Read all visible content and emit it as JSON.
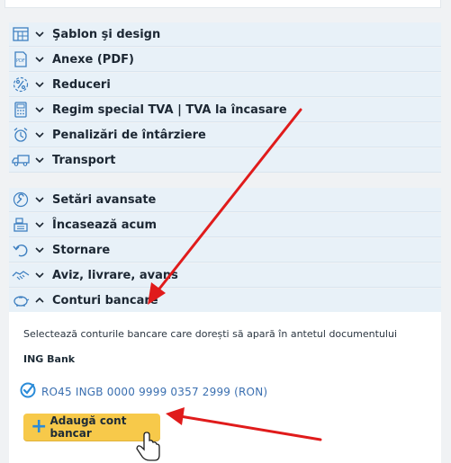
{
  "colors": {
    "accent_arrow": "#e01b1b",
    "row_bg": "#e8f1f8",
    "icon_blue": "#3d7fc0",
    "button_bg": "#f7c94a"
  },
  "sections_group1": [
    {
      "label": "Şablon şi design",
      "icon": "template-grid-icon"
    },
    {
      "label": "Anexe (PDF)",
      "icon": "pdf-file-icon"
    },
    {
      "label": "Reduceri",
      "icon": "discount-percent-icon"
    },
    {
      "label": "Regim special TVA | TVA la încasare",
      "icon": "calculator-icon"
    },
    {
      "label": "Penalizări de întârziere",
      "icon": "alarm-clock-icon"
    },
    {
      "label": "Transport",
      "icon": "truck-icon"
    }
  ],
  "sections_group2": [
    {
      "label": "Setări avansate",
      "icon": "wrench-icon"
    },
    {
      "label": "Încasează acum",
      "icon": "cash-register-icon"
    },
    {
      "label": "Stornare",
      "icon": "undo-arrow-icon"
    },
    {
      "label": "Aviz, livrare, avans",
      "icon": "handshake-icon"
    },
    {
      "label": "Conturi bancare",
      "icon": "piggy-bank-icon"
    }
  ],
  "bank_accounts": {
    "description": "Selectează conturile bancare care dorești să apară în antetul documentului",
    "bank_name": "ING Bank",
    "account_text": "RO45 INGB 0000 9999 0357 2999 (RON)",
    "add_button_label": "Adaugă cont bancar",
    "add_button_icon": "plus-icon"
  }
}
